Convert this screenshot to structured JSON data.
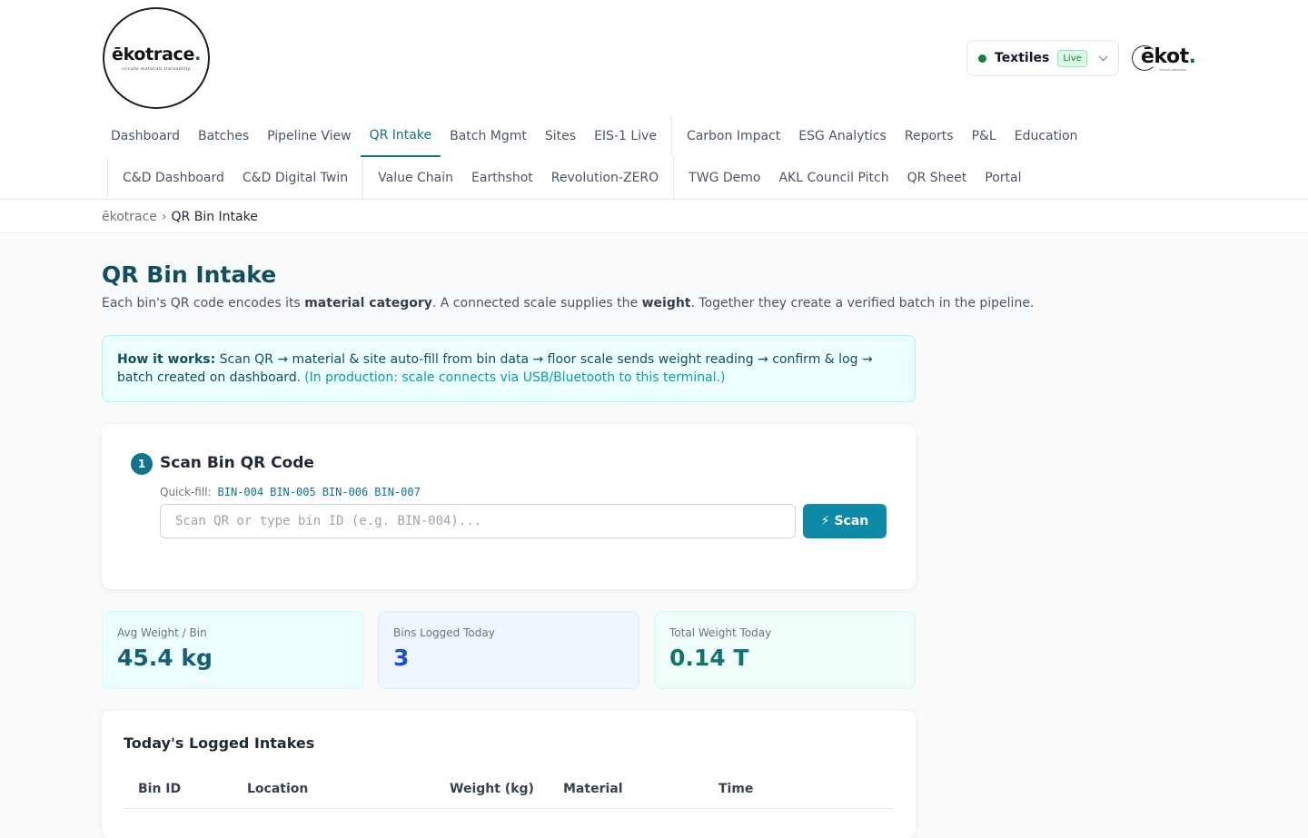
{
  "brand": {
    "logo_word": "ēkotrace",
    "logo_tagline": "circular materials traceability",
    "mark_word": "ēkot",
    "mark_tagline": "circular solutions"
  },
  "industry": {
    "label": "Textiles",
    "badge": "Live",
    "accent": "#15803d"
  },
  "nav": {
    "row1": [
      "Dashboard",
      "Batches",
      "Pipeline View",
      "QR Intake",
      "Batch Mgmt",
      "Sites",
      "EIS-1 Live",
      "Carbon Impact",
      "ESG Analytics",
      "Reports",
      "P&L",
      "Education"
    ],
    "row2": [
      "C&D Dashboard",
      "C&D Digital Twin",
      "Value Chain",
      "Earthshot",
      "Revolution-ZERO",
      "TWG Demo",
      "AKL Council Pitch",
      "QR Sheet",
      "Portal"
    ],
    "active": "QR Intake"
  },
  "breadcrumb": {
    "home": "ēkotrace",
    "sep": "›",
    "current": "QR Bin Intake"
  },
  "page": {
    "title": "QR Bin Intake",
    "desc_1": "Each bin's QR code encodes its ",
    "desc_b1": "material category",
    "desc_2": ". A connected scale supplies the ",
    "desc_b2": "weight",
    "desc_3": ". Together they create a verified batch in the pipeline."
  },
  "info": {
    "lead": "How it works:",
    "text": " Scan QR → material & site auto-fill from bin data → floor scale sends weight reading → confirm & log → batch created on dashboard.",
    "note": "(In production: scale connects via USB/Bluetooth to this terminal.)"
  },
  "scan": {
    "step": "1",
    "title": "Scan Bin QR Code",
    "quickfill_label": "Quick-fill:",
    "quickfill": [
      "BIN-004",
      "BIN-005",
      "BIN-006",
      "BIN-007"
    ],
    "placeholder": "Scan QR or type bin ID (e.g. BIN-004)...",
    "button": "⚡ Scan"
  },
  "stats": [
    {
      "label": "Avg Weight / Bin",
      "value": "45.4 kg"
    },
    {
      "label": "Bins Logged Today",
      "value": "3"
    },
    {
      "label": "Total Weight Today",
      "value": "0.14 T"
    }
  ],
  "log": {
    "title": "Today's Logged Intakes",
    "columns": [
      "Bin ID",
      "Location",
      "Weight (kg)",
      "Material",
      "Time"
    ]
  }
}
